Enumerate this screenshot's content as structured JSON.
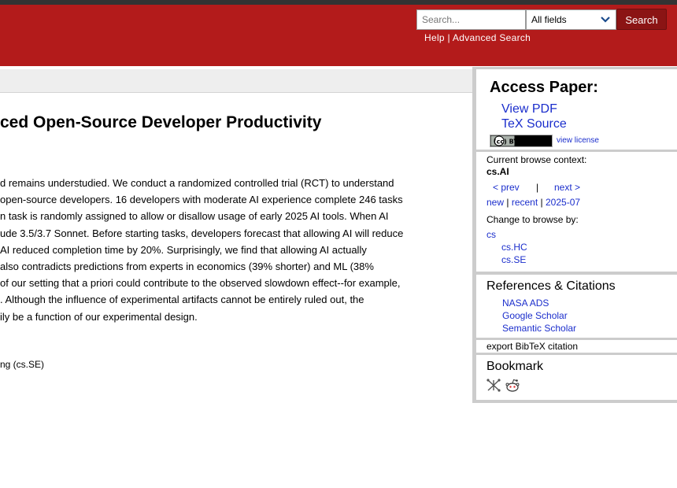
{
  "search": {
    "placeholder": "Search...",
    "field_selected": "All fields",
    "button_label": "Search"
  },
  "header_links": {
    "help": "Help",
    "separator": " | ",
    "advanced": "Advanced Search"
  },
  "paper": {
    "title": "ced Open-Source Developer Productivity",
    "abstract_lines": [
      "d remains understudied. We conduct a randomized controlled trial (RCT) to understand",
      "open-source developers. 16 developers with moderate AI experience complete 246 tasks",
      "n task is randomly assigned to allow or disallow usage of early 2025 AI tools. When AI",
      "ude 3.5/3.7 Sonnet. Before starting tasks, developers forecast that allowing AI will reduce",
      "AI reduced completion time by 20%. Surprisingly, we find that allowing AI actually",
      " also contradicts predictions from experts in economics (39% shorter) and ML (38%",
      " of our setting that a priori could contribute to the observed slowdown effect--for example,",
      ". Although the influence of experimental artifacts cannot be entirely ruled out, the",
      "ily be a function of our experimental design."
    ],
    "subjects": "ng (cs.SE)"
  },
  "sidebar": {
    "access": {
      "title": "Access Paper:",
      "view_pdf": "View PDF",
      "tex_source": "TeX Source",
      "license_badge": "(cc) BY",
      "view_license": "view license"
    },
    "browse": {
      "context_label": "Current browse context:",
      "context": "cs.AI",
      "prev": "< prev",
      "divider": "|",
      "next": "next >",
      "new": "new",
      "recent": "recent",
      "month": "2025-07",
      "sep": "|",
      "change_label": "Change to browse by:",
      "categories": [
        "cs",
        "cs.HC",
        "cs.SE"
      ]
    },
    "refs": {
      "title": "References & Citations",
      "links": [
        "NASA ADS",
        "Google Scholar",
        "Semantic Scholar"
      ]
    },
    "bibtex": "export BibTeX citation",
    "bookmark": {
      "title": "Bookmark",
      "icons": [
        "bibsonomy-icon",
        "reddit-icon"
      ]
    }
  },
  "colors": {
    "header": "#b31b1b",
    "search_button": "#8b1414",
    "link": "#1b2ecc",
    "topbar": "#333333"
  }
}
